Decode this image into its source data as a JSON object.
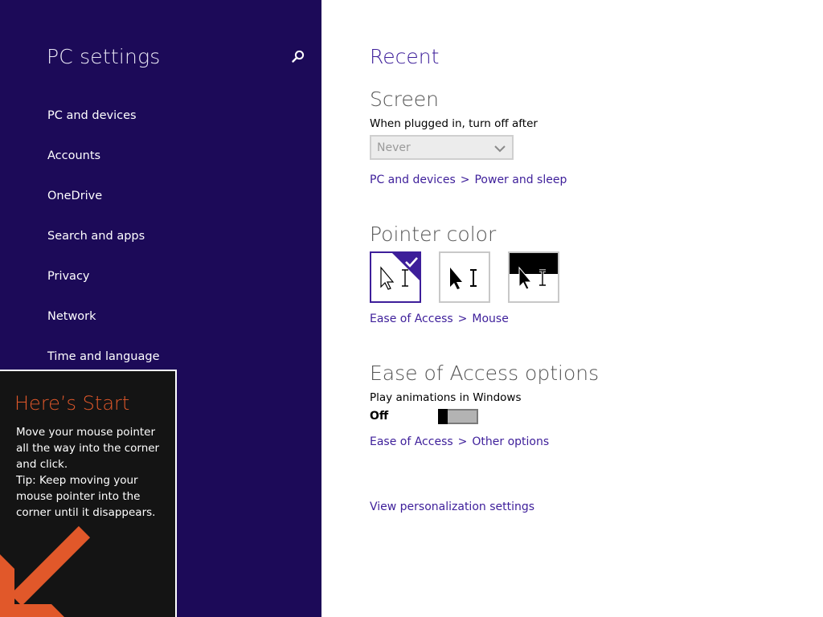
{
  "sidebar": {
    "title": "PC settings",
    "search_icon": "search-icon",
    "items": [
      {
        "label": "PC and devices"
      },
      {
        "label": "Accounts"
      },
      {
        "label": "OneDrive"
      },
      {
        "label": "Search and apps"
      },
      {
        "label": "Privacy"
      },
      {
        "label": "Network"
      },
      {
        "label": "Time and language"
      }
    ]
  },
  "start_tip": {
    "title": "Here’s Start",
    "lines": [
      "Move your mouse pointer",
      "all the way into the corner",
      "and click.",
      "Tip: Keep moving your",
      "mouse pointer into the",
      "corner until it disappears."
    ],
    "arrow_icon": "arrow-down-left-icon"
  },
  "main": {
    "heading": "Recent",
    "screen": {
      "title": "Screen",
      "label": "When plugged in, turn off after",
      "select_value": "Never",
      "link_parts": [
        "PC and devices",
        ">",
        "Power and sleep"
      ]
    },
    "pointer": {
      "title": "Pointer color",
      "options": [
        "white-pointer",
        "black-pointer",
        "inverted-pointer"
      ],
      "selected_index": 0,
      "link_parts": [
        "Ease of Access",
        ">",
        "Mouse"
      ]
    },
    "ease": {
      "title": "Ease of Access options",
      "label": "Play animations in Windows",
      "toggle_state": "Off",
      "link_parts": [
        "Ease of Access",
        ">",
        "Other options"
      ]
    },
    "personalization_link": "View personalization settings"
  },
  "colors": {
    "sidebar_bg": "#1c0a58",
    "accent": "#3d1e9a",
    "tip_title": "#e1582a"
  }
}
